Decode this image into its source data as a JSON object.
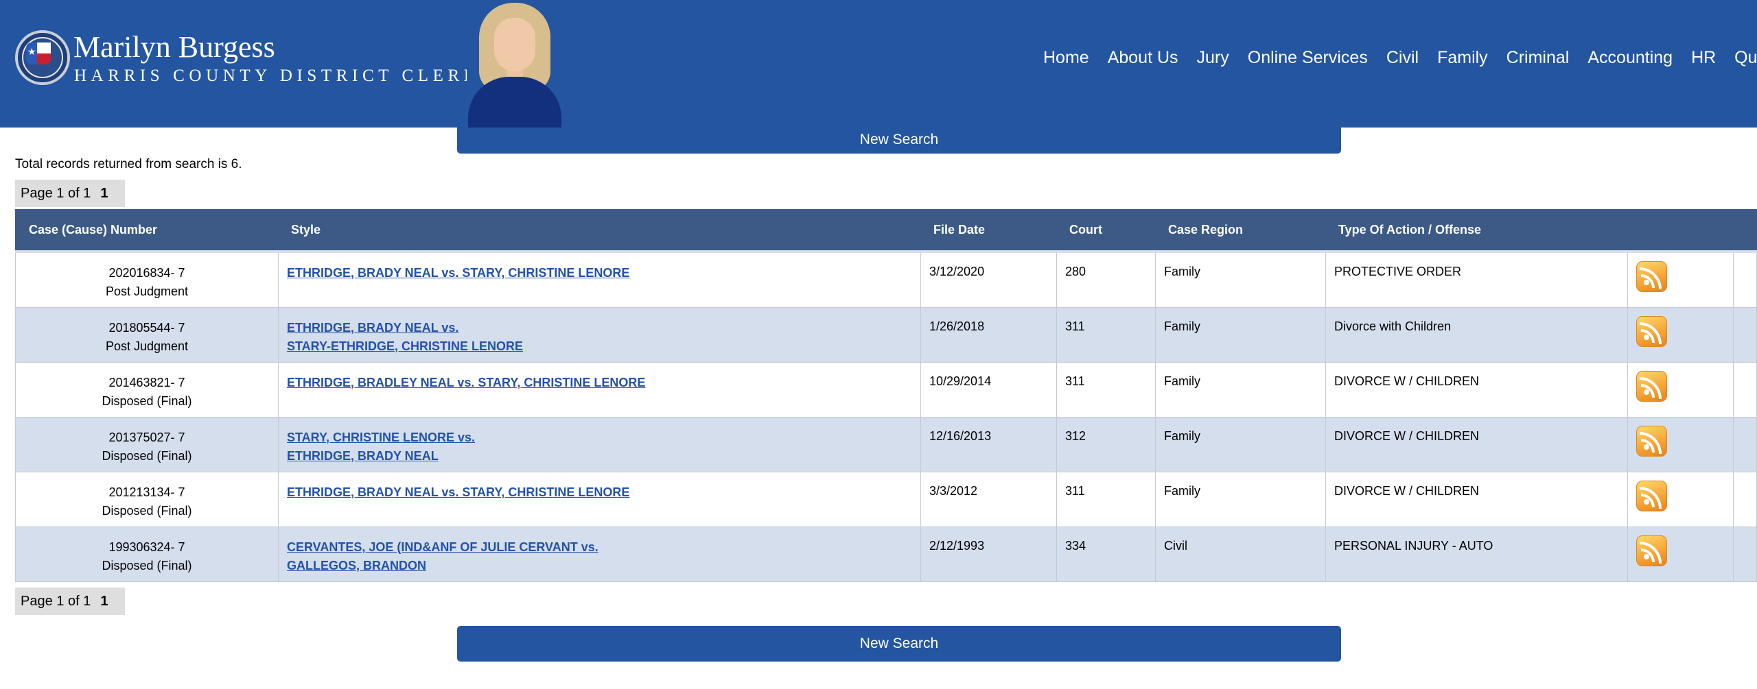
{
  "header": {
    "clerk_name": "Marilyn Burgess",
    "clerk_title": "HARRIS COUNTY DISTRICT CLERK",
    "nav": [
      "Home",
      "About Us",
      "Jury",
      "Online Services",
      "Civil",
      "Family",
      "Criminal",
      "Accounting",
      "HR",
      "Quick Lin"
    ]
  },
  "new_search_label": "New Search",
  "total_text": "Total records returned from search is 6.",
  "pager": {
    "text": "Page 1 of 1",
    "current": "1"
  },
  "table": {
    "columns": [
      "Case (Cause) Number",
      "Style",
      "File Date",
      "Court",
      "Case Region",
      "Type Of Action / Offense"
    ],
    "rows": [
      {
        "case_number": "202016834- 7",
        "status": "Post Judgment",
        "style_line1": "ETHRIDGE, BRADY NEAL vs. STARY, CHRISTINE LENORE",
        "style_line2": "",
        "file_date": "3/12/2020",
        "court": "280",
        "region": "Family",
        "action": "PROTECTIVE ORDER"
      },
      {
        "case_number": "201805544- 7",
        "status": "Post Judgment",
        "style_line1": "ETHRIDGE, BRADY NEAL vs.",
        "style_line2": "STARY-ETHRIDGE, CHRISTINE LENORE",
        "file_date": "1/26/2018",
        "court": "311",
        "region": "Family",
        "action": "Divorce with Children"
      },
      {
        "case_number": "201463821- 7",
        "status": "Disposed (Final)",
        "style_line1": "ETHRIDGE, BRADLEY NEAL vs. STARY, CHRISTINE LENORE",
        "style_line2": "",
        "file_date": "10/29/2014",
        "court": "311",
        "region": "Family",
        "action": "DIVORCE W / CHILDREN"
      },
      {
        "case_number": "201375027- 7",
        "status": "Disposed (Final)",
        "style_line1": "STARY, CHRISTINE LENORE vs.",
        "style_line2": "ETHRIDGE, BRADY NEAL",
        "file_date": "12/16/2013",
        "court": "312",
        "region": "Family",
        "action": "DIVORCE W / CHILDREN"
      },
      {
        "case_number": "201213134- 7",
        "status": "Disposed (Final)",
        "style_line1": "ETHRIDGE, BRADY NEAL vs. STARY, CHRISTINE LENORE",
        "style_line2": "",
        "file_date": "3/3/2012",
        "court": "311",
        "region": "Family",
        "action": "DIVORCE W / CHILDREN"
      },
      {
        "case_number": "199306324- 7",
        "status": "Disposed (Final)",
        "style_line1": "CERVANTES, JOE (IND&ANF OF JULIE CERVANT vs.",
        "style_line2": "GALLEGOS, BRANDON",
        "file_date": "2/12/1993",
        "court": "334",
        "region": "Civil",
        "action": "PERSONAL INJURY - AUTO"
      }
    ]
  },
  "icons": {
    "seal": "harris-county-seal-icon",
    "rss": "rss-feed-icon"
  },
  "colors": {
    "header_bg": "#2355a0",
    "table_header_bg": "#3c5a85",
    "row_alt_bg": "#d5deed",
    "link": "#2252a8"
  }
}
